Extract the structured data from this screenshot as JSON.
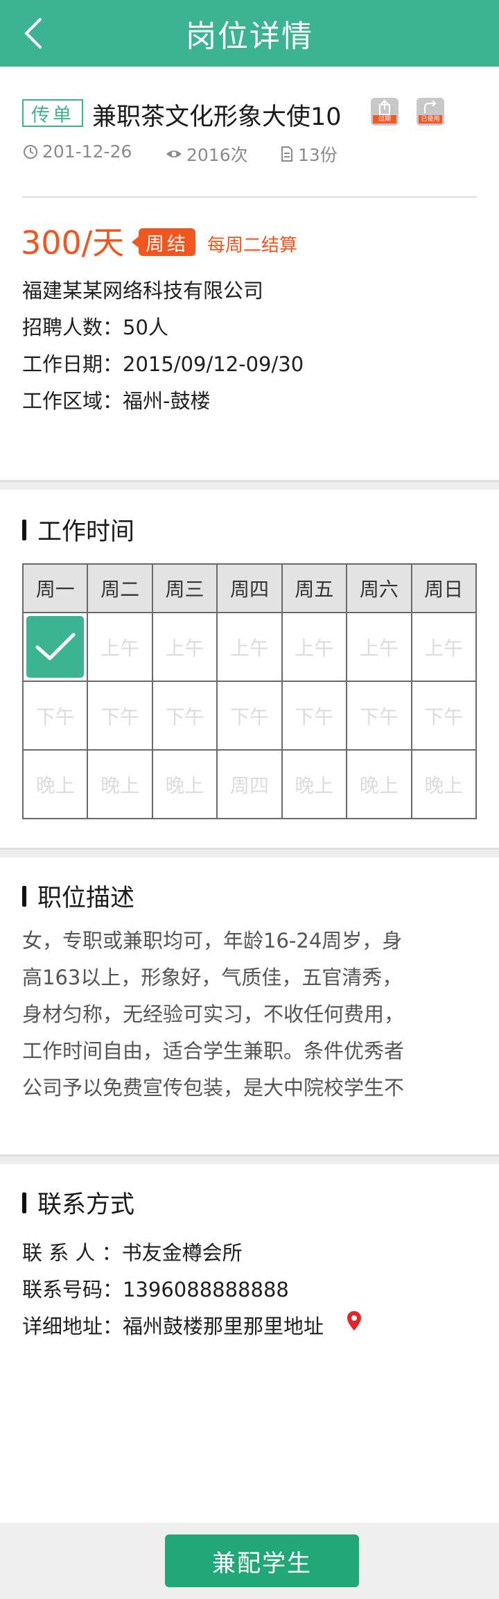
{
  "header": {
    "title": "岗位详情"
  },
  "job": {
    "tag": "传单",
    "title": "兼职茶文化形象大使10",
    "status_icons": [
      {
        "icon": "share-icon",
        "label": "过期"
      },
      {
        "icon": "redo-icon",
        "label": "已使用"
      }
    ],
    "date": "201-12-26",
    "views": "2016次",
    "copies": "13份",
    "salary": "300/天",
    "settle_badge": "周结",
    "settle_text": "每周二结算",
    "company": "福建某某网络科技有限公司",
    "recruit_count": "招聘人数：50人",
    "work_date": "工作日期：2015/09/12-09/30",
    "work_area": "工作区域：福州-鼓楼"
  },
  "schedule": {
    "title": "工作时间",
    "days": [
      "周一",
      "周二",
      "周三",
      "周四",
      "周五",
      "周六",
      "周日"
    ],
    "rows": [
      [
        "",
        "上午",
        "上午",
        "上午",
        "上午",
        "上午",
        "上午"
      ],
      [
        "下午",
        "下午",
        "下午",
        "下午",
        "下午",
        "下午",
        "下午"
      ],
      [
        "晚上",
        "晚上",
        "晚上",
        "周四",
        "晚上",
        "晚上",
        "晚上"
      ]
    ],
    "checked": [
      [
        true,
        false,
        false,
        false,
        false,
        false,
        false
      ],
      [
        false,
        false,
        false,
        false,
        false,
        false,
        false
      ],
      [
        false,
        false,
        false,
        false,
        false,
        false,
        false
      ]
    ]
  },
  "description": {
    "title": "职位描述",
    "lines": [
      "女，专职或兼职均可，年龄16-24周岁，身",
      "高163以上，形象好，气质佳，五官清秀，",
      "身材匀称，无经验可实习，不收任何费用，",
      "工作时间自由，适合学生兼职。条件优秀者",
      "公司予以免费宣传包装，是大中院校学生不"
    ]
  },
  "contact": {
    "title": "联系方式",
    "person": "联 系 人 ：书友金樽会所",
    "phone": "联系号码：1396088888888",
    "address": "详细地址：福州鼓楼那里那里地址"
  },
  "cta": {
    "label": "兼配学生"
  },
  "colors": {
    "primary": "#3cb391",
    "accent": "#f0561d",
    "cta": "#22a878"
  }
}
